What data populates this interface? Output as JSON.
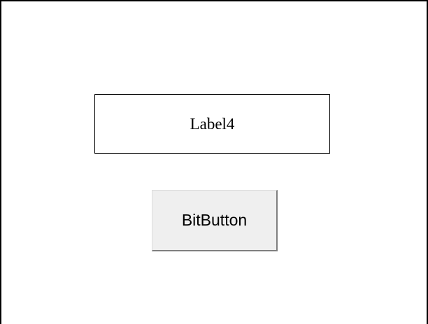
{
  "form": {
    "label_text": "Label4",
    "button_label": "BitButton"
  },
  "colors": {
    "background": "#ffffff",
    "border": "#000000",
    "button_face": "#efefef",
    "button_shadow": "#7f7f7f"
  }
}
